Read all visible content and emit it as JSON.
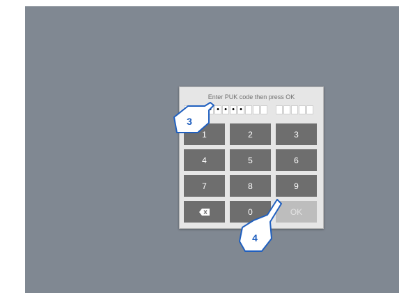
{
  "dialog": {
    "prompt": "Enter PUK code then press OK",
    "entered_digit_count": 8,
    "total_digit_count": 16
  },
  "keypad": {
    "keys": [
      "1",
      "2",
      "3",
      "4",
      "5",
      "6",
      "7",
      "8",
      "9",
      "",
      "0",
      "OK"
    ],
    "backspace_icon": "backspace-icon"
  },
  "annotations": {
    "step_a": "3",
    "step_b": "4",
    "callout_color": "#1f5fbf"
  }
}
